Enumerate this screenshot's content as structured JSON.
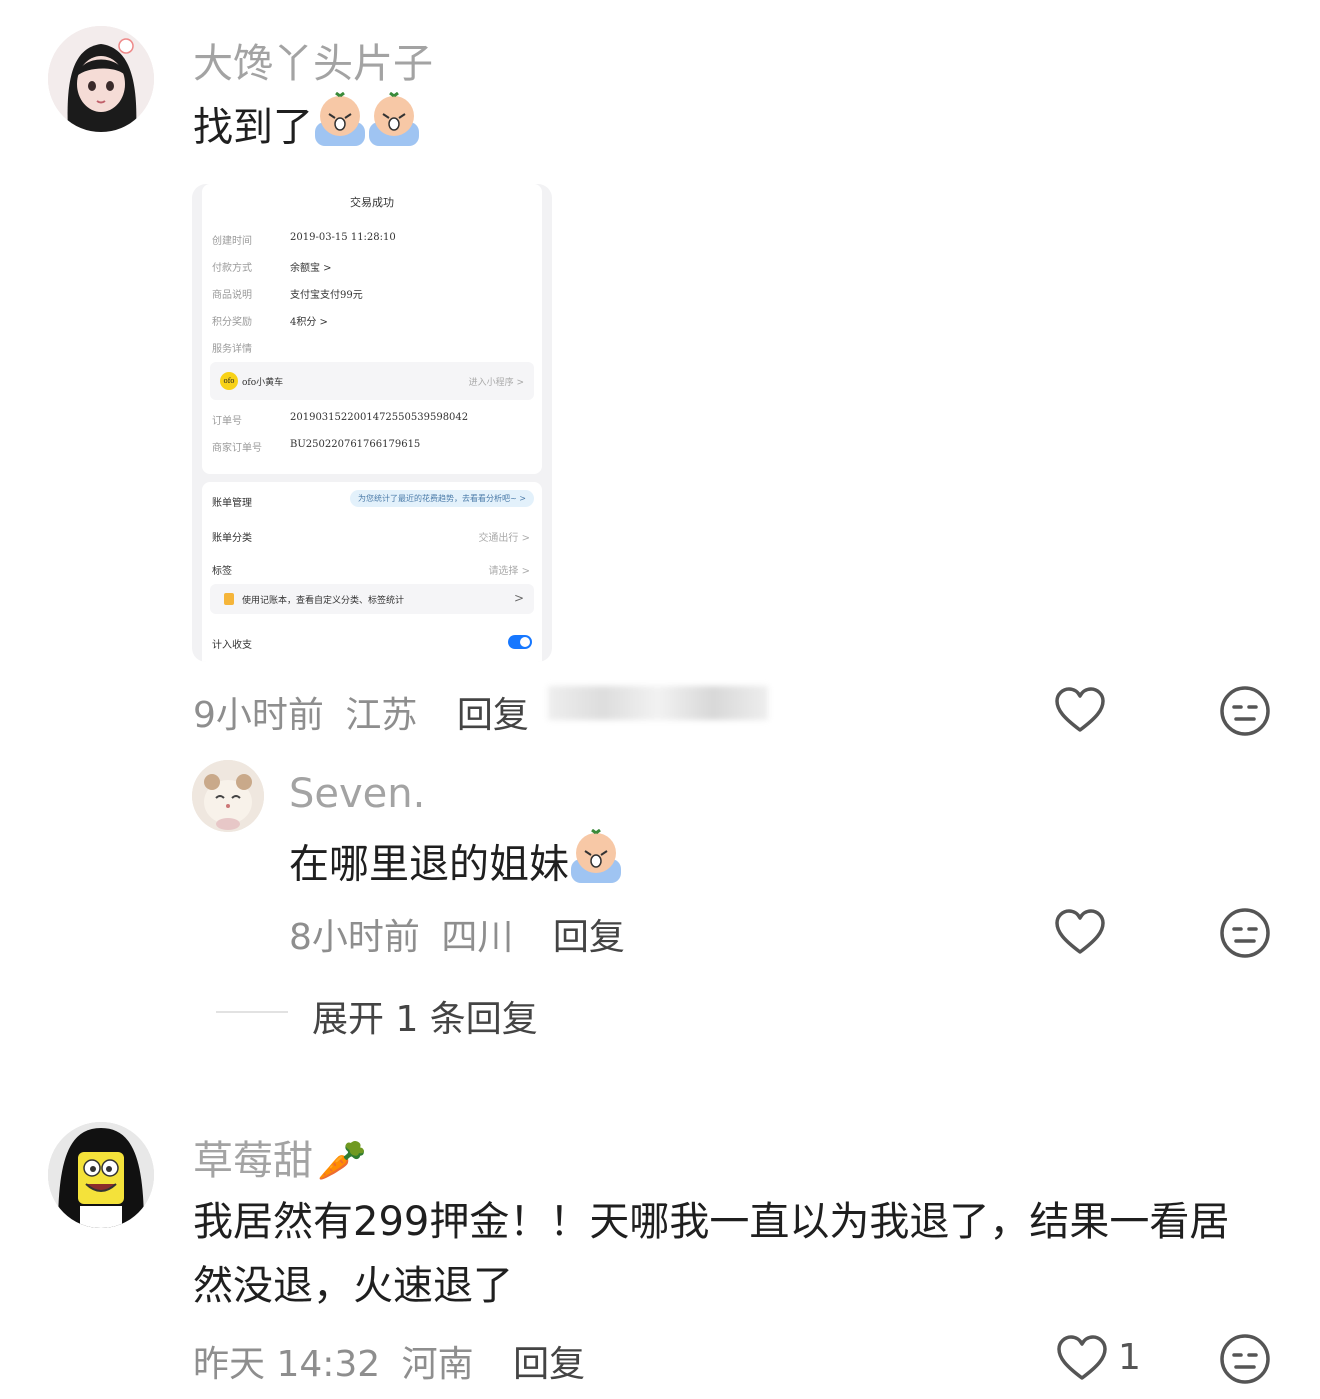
{
  "comments": [
    {
      "username": "大馋丫头片子",
      "text": "找到了",
      "screenshot": {
        "title": "交易成功",
        "rows": [
          {
            "label": "创建时间",
            "value": "2019-03-15 11:28:10"
          },
          {
            "label": "付款方式",
            "value": "余额宝 >"
          },
          {
            "label": "商品说明",
            "value": "支付宝支付99元"
          },
          {
            "label": "积分奖励",
            "value": "4积分 >"
          },
          {
            "label": "服务详情",
            "value": ""
          }
        ],
        "service_name": "ofo小黄车",
        "service_logo": "ofo",
        "service_link": "进入小程序 >",
        "order_rows": [
          {
            "label": "订单号",
            "value": "2019031522001472550539598042"
          },
          {
            "label": "商家订单号",
            "value": "BU250220761766179615"
          }
        ],
        "bill_manage_label": "账单管理",
        "bill_manage_tip": "为您统计了最近的花费趋势，去看看分析吧~ >",
        "bill_category_label": "账单分类",
        "bill_category_value": "交通出行 >",
        "tag_label": "标签",
        "tag_value": "请选择 >",
        "notebook_tip": "使用记账本，查看自定义分类、标签统计",
        "notebook_chevron": ">",
        "income_label": "计入收支"
      },
      "time": "9小时前",
      "location": "江苏",
      "reply_label": "回复"
    },
    {
      "username": "Seven.",
      "text": "在哪里退的姐妹",
      "time": "8小时前",
      "location": "四川",
      "reply_label": "回复"
    },
    {
      "username": "草莓甜",
      "username_emoji": "🥕",
      "text_line1": "我居然有299押金！！天哪我一直以为我退了，结果一看居",
      "text_line2": "然没退，火速退了",
      "time": "昨天 14:32",
      "location": "河南",
      "reply_label": "回复",
      "like_count": "1"
    }
  ],
  "expand_replies": "展开 1 条回复",
  "colors": {
    "muted": "#a3a3a3",
    "text": "#1f1f1f",
    "toggle": "#1677ff",
    "icon": "#555555"
  }
}
